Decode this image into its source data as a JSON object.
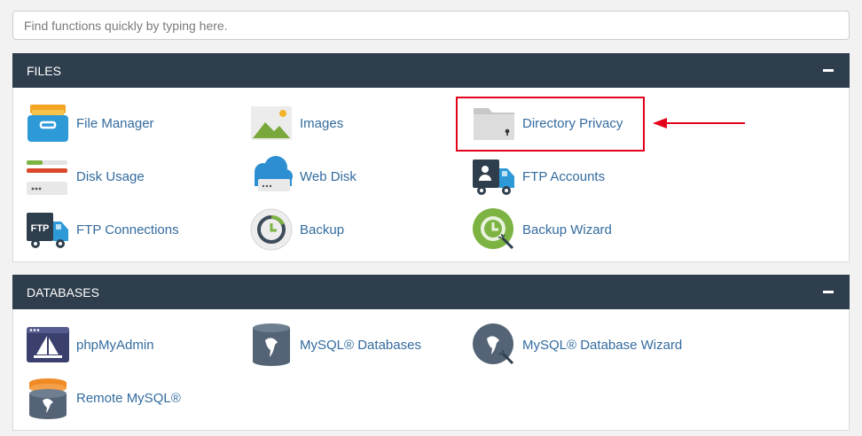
{
  "search": {
    "placeholder": "Find functions quickly by typing here."
  },
  "sections": [
    {
      "title": "FILES",
      "items": [
        {
          "label": "File Manager",
          "icon": "file-manager-icon"
        },
        {
          "label": "Images",
          "icon": "images-icon"
        },
        {
          "label": "Directory Privacy",
          "icon": "directory-privacy-icon"
        },
        {
          "label": "Disk Usage",
          "icon": "disk-usage-icon"
        },
        {
          "label": "Web Disk",
          "icon": "web-disk-icon"
        },
        {
          "label": "FTP Accounts",
          "icon": "ftp-accounts-icon"
        },
        {
          "label": "FTP Connections",
          "icon": "ftp-connections-icon"
        },
        {
          "label": "Backup",
          "icon": "backup-icon"
        },
        {
          "label": "Backup Wizard",
          "icon": "backup-wizard-icon"
        }
      ]
    },
    {
      "title": "DATABASES",
      "items": [
        {
          "label": "phpMyAdmin",
          "icon": "phpmyadmin-icon"
        },
        {
          "label": "MySQL® Databases",
          "icon": "mysql-databases-icon"
        },
        {
          "label": "MySQL® Database Wizard",
          "icon": "mysql-database-wizard-icon"
        },
        {
          "label": "Remote MySQL®",
          "icon": "remote-mysql-icon"
        }
      ]
    }
  ],
  "ftp_badge": "FTP",
  "colors": {
    "header": "#2f3e4d",
    "link": "#336b9f",
    "highlight": "#e3001b"
  }
}
